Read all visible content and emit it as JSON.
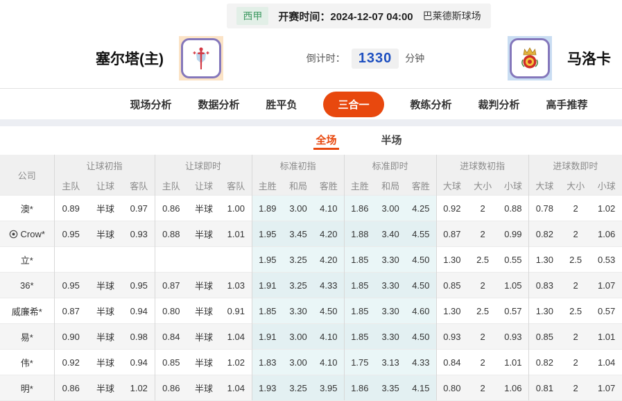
{
  "header": {
    "league": "西甲",
    "kickoff_label": "开赛时间：",
    "kickoff_time": "2024-12-07 04:00",
    "venue": "巴莱德斯球场",
    "home_team": "塞尔塔(主)",
    "away_team": "马洛卡",
    "countdown_label": "倒计时：",
    "countdown_value": "1330",
    "countdown_unit": "分钟"
  },
  "nav_tabs": [
    {
      "label": "现场分析",
      "active": false
    },
    {
      "label": "数据分析",
      "active": false
    },
    {
      "label": "胜平负",
      "active": false
    },
    {
      "label": "三合一",
      "active": true
    },
    {
      "label": "教练分析",
      "active": false
    },
    {
      "label": "裁判分析",
      "active": false
    },
    {
      "label": "高手推荐",
      "active": false
    }
  ],
  "sub_tabs": [
    {
      "label": "全场",
      "active": true
    },
    {
      "label": "半场",
      "active": false
    }
  ],
  "table": {
    "company_header": "公司",
    "groups": [
      {
        "label": "让球初指",
        "cols": [
          "主队",
          "让球",
          "客队"
        ],
        "live": false,
        "tint": false
      },
      {
        "label": "让球即时",
        "cols": [
          "主队",
          "让球",
          "客队"
        ],
        "live": true,
        "tint": false
      },
      {
        "label": "标准初指",
        "cols": [
          "主胜",
          "和局",
          "客胜"
        ],
        "live": false,
        "tint": true
      },
      {
        "label": "标准即时",
        "cols": [
          "主胜",
          "和局",
          "客胜"
        ],
        "live": true,
        "tint": true
      },
      {
        "label": "进球数初指",
        "cols": [
          "大球",
          "大小",
          "小球"
        ],
        "live": false,
        "tint": false
      },
      {
        "label": "进球数即时",
        "cols": [
          "大球",
          "大小",
          "小球"
        ],
        "live": true,
        "tint": false
      }
    ],
    "rows": [
      {
        "company": "澳*",
        "ball_icon": false,
        "values": [
          [
            "0.89",
            "半球",
            "0.97"
          ],
          [
            "0.86",
            "半球",
            "1.00"
          ],
          [
            "1.89",
            "3.00",
            "4.10"
          ],
          [
            "1.86",
            "3.00",
            "4.25"
          ],
          [
            "0.92",
            "2",
            "0.88"
          ],
          [
            "0.78",
            "2",
            "1.02"
          ]
        ]
      },
      {
        "company": "Crow*",
        "ball_icon": true,
        "values": [
          [
            "0.95",
            "半球",
            "0.93"
          ],
          [
            "0.88",
            "半球",
            "1.01"
          ],
          [
            "1.95",
            "3.45",
            "4.20"
          ],
          [
            "1.88",
            "3.40",
            "4.55"
          ],
          [
            "0.87",
            "2",
            "0.99"
          ],
          [
            "0.82",
            "2",
            "1.06"
          ]
        ]
      },
      {
        "company": "立*",
        "ball_icon": false,
        "values": [
          [
            "",
            "",
            ""
          ],
          [
            "",
            "",
            ""
          ],
          [
            "1.95",
            "3.25",
            "4.20"
          ],
          [
            "1.85",
            "3.30",
            "4.50"
          ],
          [
            "1.30",
            "2.5",
            "0.55"
          ],
          [
            "1.30",
            "2.5",
            "0.53"
          ]
        ]
      },
      {
        "company": "36*",
        "ball_icon": false,
        "values": [
          [
            "0.95",
            "半球",
            "0.95"
          ],
          [
            "0.87",
            "半球",
            "1.03"
          ],
          [
            "1.91",
            "3.25",
            "4.33"
          ],
          [
            "1.85",
            "3.30",
            "4.50"
          ],
          [
            "0.85",
            "2",
            "1.05"
          ],
          [
            "0.83",
            "2",
            "1.07"
          ]
        ]
      },
      {
        "company": "威廉希*",
        "ball_icon": false,
        "values": [
          [
            "0.87",
            "半球",
            "0.94"
          ],
          [
            "0.80",
            "半球",
            "0.91"
          ],
          [
            "1.85",
            "3.30",
            "4.50"
          ],
          [
            "1.85",
            "3.30",
            "4.60"
          ],
          [
            "1.30",
            "2.5",
            "0.57"
          ],
          [
            "1.30",
            "2.5",
            "0.57"
          ]
        ]
      },
      {
        "company": "易*",
        "ball_icon": false,
        "values": [
          [
            "0.90",
            "半球",
            "0.98"
          ],
          [
            "0.84",
            "半球",
            "1.04"
          ],
          [
            "1.91",
            "3.00",
            "4.10"
          ],
          [
            "1.85",
            "3.30",
            "4.50"
          ],
          [
            "0.93",
            "2",
            "0.93"
          ],
          [
            "0.85",
            "2",
            "1.01"
          ]
        ]
      },
      {
        "company": "伟*",
        "ball_icon": false,
        "values": [
          [
            "0.92",
            "半球",
            "0.94"
          ],
          [
            "0.85",
            "半球",
            "1.02"
          ],
          [
            "1.83",
            "3.00",
            "4.10"
          ],
          [
            "1.75",
            "3.13",
            "4.33"
          ],
          [
            "0.84",
            "2",
            "1.01"
          ],
          [
            "0.82",
            "2",
            "1.04"
          ]
        ]
      },
      {
        "company": "明*",
        "ball_icon": false,
        "values": [
          [
            "0.86",
            "半球",
            "1.02"
          ],
          [
            "0.86",
            "半球",
            "1.04"
          ],
          [
            "1.93",
            "3.25",
            "3.95"
          ],
          [
            "1.86",
            "3.35",
            "4.15"
          ],
          [
            "0.80",
            "2",
            "1.06"
          ],
          [
            "0.81",
            "2",
            "1.07"
          ]
        ]
      }
    ]
  },
  "colors": {
    "accent": "#e8480e",
    "live_blue": "#2b6bc8",
    "countdown_blue": "#1d4fc0",
    "league_green": "#3f9a62",
    "tint_cyan": "#eaf6f7"
  }
}
